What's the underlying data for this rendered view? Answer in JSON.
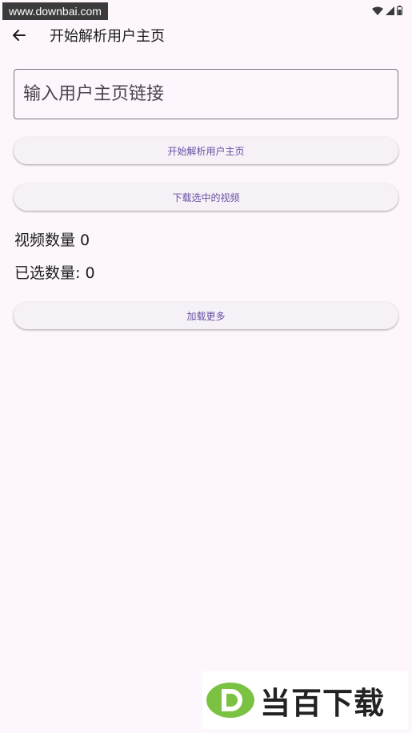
{
  "status_bar": {
    "watermark": "www.downbai.com",
    "icons": [
      "wifi-icon",
      "signal-icon",
      "battery-icon"
    ]
  },
  "app_bar": {
    "back_icon": "arrow-left-icon",
    "title": "开始解析用户主页"
  },
  "url_input": {
    "placeholder": "输入用户主页链接",
    "value": ""
  },
  "buttons": {
    "parse_label": "开始解析用户主页",
    "download_label": "下载选中的视频",
    "load_more_label": "加载更多"
  },
  "counts": {
    "video_count_text": "视频数量 0",
    "selected_count_text": "已选数量: 0"
  },
  "watermark_bottom": {
    "logo_letter": "D",
    "brand_text": "当百下载"
  },
  "colors": {
    "background": "#fdf7fd",
    "button_bg": "#f6f1f7",
    "button_text": "#6750a4",
    "logo_green": "#7cc242"
  }
}
